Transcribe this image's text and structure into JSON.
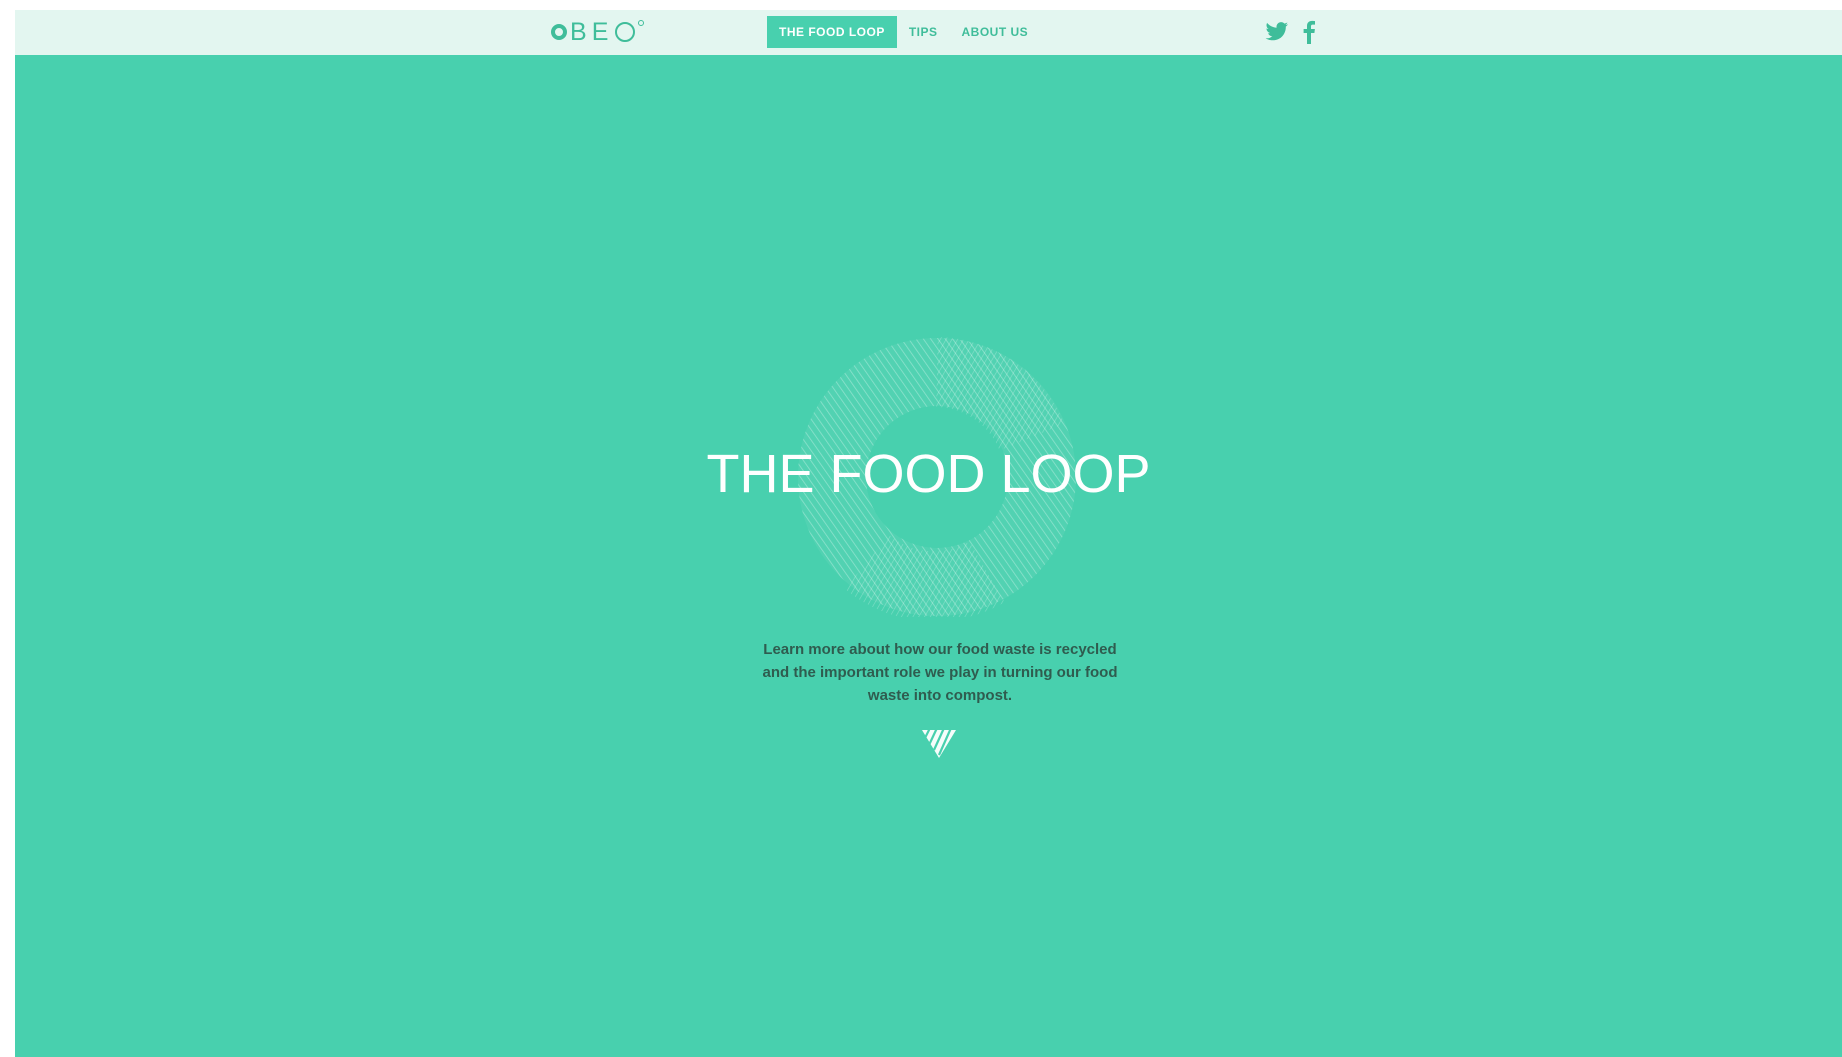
{
  "header": {
    "logo": {
      "letters": [
        "B",
        "E"
      ],
      "label": "OBEO"
    },
    "nav": [
      {
        "label": "THE FOOD LOOP",
        "active": true
      },
      {
        "label": "TIPS",
        "active": false
      },
      {
        "label": "ABOUT US",
        "active": false
      }
    ],
    "social": [
      {
        "icon": "twitter-icon"
      },
      {
        "icon": "facebook-icon"
      }
    ]
  },
  "hero": {
    "title": "THE FOOD LOOP",
    "description": "Learn more about how our food waste is recycled and the important role we play in turning our food waste into compost.",
    "scroll_icon": "chevron-down-icon"
  },
  "colors": {
    "background": "#48d0ae",
    "topbar": "#e3f6f0",
    "accent": "#3fbd9a",
    "text_dark": "#2f5c4f",
    "text_light": "#ffffff"
  }
}
